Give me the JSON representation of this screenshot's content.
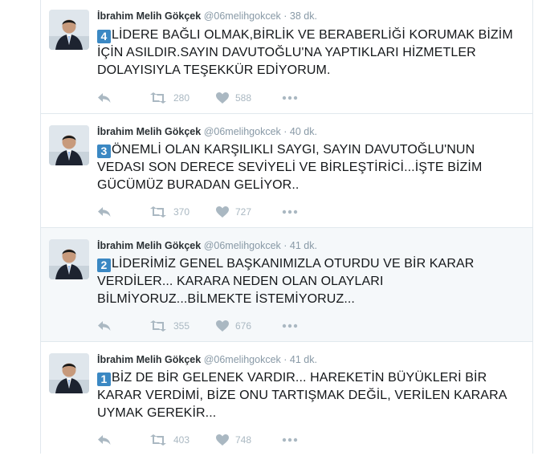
{
  "tweets": [
    {
      "name": "İbrahim Melih Gökçek",
      "handle": "@06melihgokcek",
      "sep": "·",
      "time": "38 dk.",
      "number": "4",
      "text": "LİDERE BAĞLI OLMAK,BİRLİK VE BERABERLİĞİ KORUMAK BİZİM İÇİN ASILDIR.SAYIN DAVUTOĞLU'NA YAPTIKLARI HİZMETLER DOLAYISIYLA TEŞEKKÜR EDİYORUM.",
      "retweets": "280",
      "likes": "588"
    },
    {
      "name": "İbrahim Melih Gökçek",
      "handle": "@06melihgokcek",
      "sep": "·",
      "time": "40 dk.",
      "number": "3",
      "text": "ÖNEMLİ OLAN KARŞILIKLI SAYGI, SAYIN DAVUTOĞLU'NUN VEDASI SON DERECE SEVİYELİ VE BİRLEŞTİRİCİ...İŞTE BİZİM GÜCÜMÜZ BURADAN GELİYOR..",
      "retweets": "370",
      "likes": "727"
    },
    {
      "name": "İbrahim Melih Gökçek",
      "handle": "@06melihgokcek",
      "sep": "·",
      "time": "41 dk.",
      "number": "2",
      "text": "LİDERİMİZ GENEL BAŞKANIMIZLA OTURDU VE BİR KARAR VERDİLER... KARARA NEDEN OLAN OLAYLARI BİLMİYORUZ...BİLMEKTE İSTEMİYORUZ...",
      "retweets": "355",
      "likes": "676"
    },
    {
      "name": "İbrahim Melih Gökçek",
      "handle": "@06melihgokcek",
      "sep": "·",
      "time": "41 dk.",
      "number": "1",
      "text": "BİZ DE BİR GELENEK VARDIR... HAREKETİN BÜYÜKLERİ BİR KARAR VERDİMİ, BİZE ONU TARTIŞMAK DEĞİL, VERİLEN KARARA UYMAK GEREKİR...",
      "retweets": "403",
      "likes": "748"
    }
  ],
  "icons": {
    "reply": "reply-icon",
    "retweet": "retweet-icon",
    "like": "heart-icon",
    "more": "more-icon"
  },
  "colors": {
    "keycap": "#3b88c3",
    "action_gray": "#aab8c2",
    "meta_gray": "#8899a6"
  }
}
